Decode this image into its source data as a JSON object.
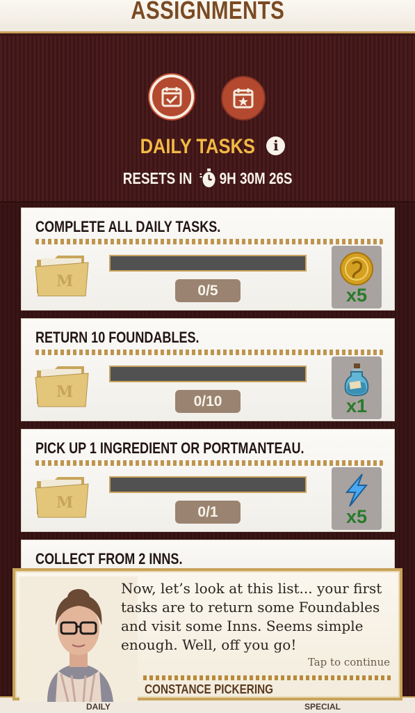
{
  "page": {
    "title": "ASSIGNMENTS"
  },
  "header": {
    "tabs": [
      {
        "icon": "calendar-check-icon",
        "active": true
      },
      {
        "icon": "calendar-star-icon",
        "active": false
      }
    ],
    "section_title": "DAILY TASKS",
    "info_icon": "i",
    "resets_label": "RESETS IN",
    "reset_timer": "9H 30M 26S"
  },
  "tasks": [
    {
      "title": "COMPLETE ALL DAILY TASKS.",
      "progress": "0/5",
      "progress_fraction": 0,
      "reward_icon": "gold-coin-icon",
      "reward_qty": "x5"
    },
    {
      "title": "RETURN 10 FOUNDABLES.",
      "progress": "0/10",
      "progress_fraction": 0,
      "reward_icon": "potion-bottle-icon",
      "reward_qty": "x1"
    },
    {
      "title": "PICK UP 1 INGREDIENT OR PORTMANTEAU.",
      "progress": "0/1",
      "progress_fraction": 0,
      "reward_icon": "spell-energy-icon",
      "reward_qty": "x5"
    },
    {
      "title": "COLLECT FROM 2 INNS."
    }
  ],
  "dialog": {
    "text": "Now, let’s look at this list... your first tasks are to return some Foundables and visit some Inns. Seems simple enough. Well, off you go!",
    "tap_to_continue": "Tap to continue",
    "speaker": "CONSTANCE PICKERING"
  },
  "bottom_nav": {
    "left": "DAILY",
    "right": "SPECIAL"
  },
  "colors": {
    "accent_gold": "#f2b945",
    "brand_maroon": "#4a1c1d",
    "reward_green": "#2a7a2a"
  }
}
